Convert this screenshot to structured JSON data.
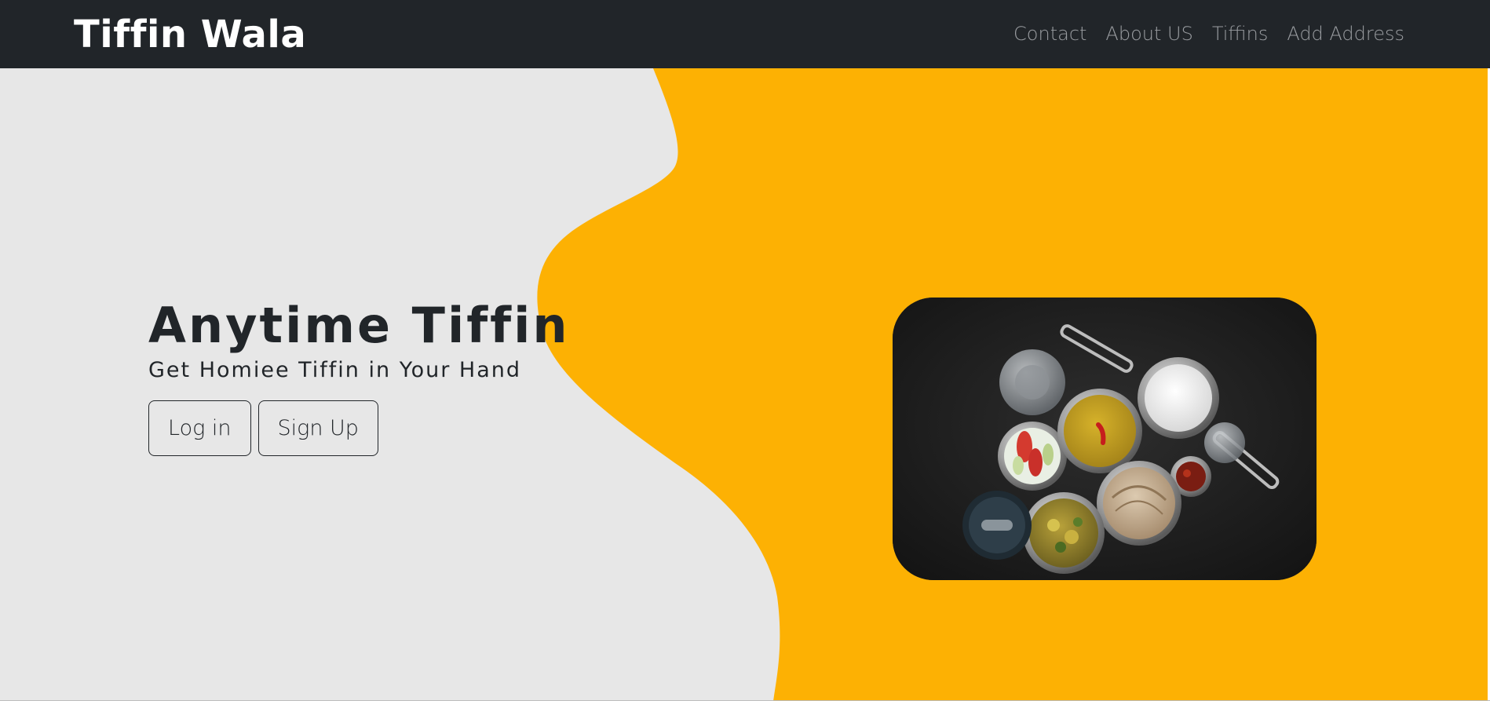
{
  "navbar": {
    "brand": "Tiffin Wala",
    "links": [
      "Contact",
      "About US",
      "Tiffins",
      "Add Address"
    ]
  },
  "hero": {
    "title": "Anytime Tiffin",
    "subtitle": "Get Homiee Tiffin in Your Hand",
    "login_label": "Log in",
    "signup_label": "Sign Up"
  },
  "colors": {
    "navbar_bg": "#212529",
    "hero_left_bg": "#e7e7e7",
    "hero_accent": "#fdb103",
    "text_dark": "#212529"
  },
  "icons": {
    "food_image": "tiffin-thali-photo"
  }
}
